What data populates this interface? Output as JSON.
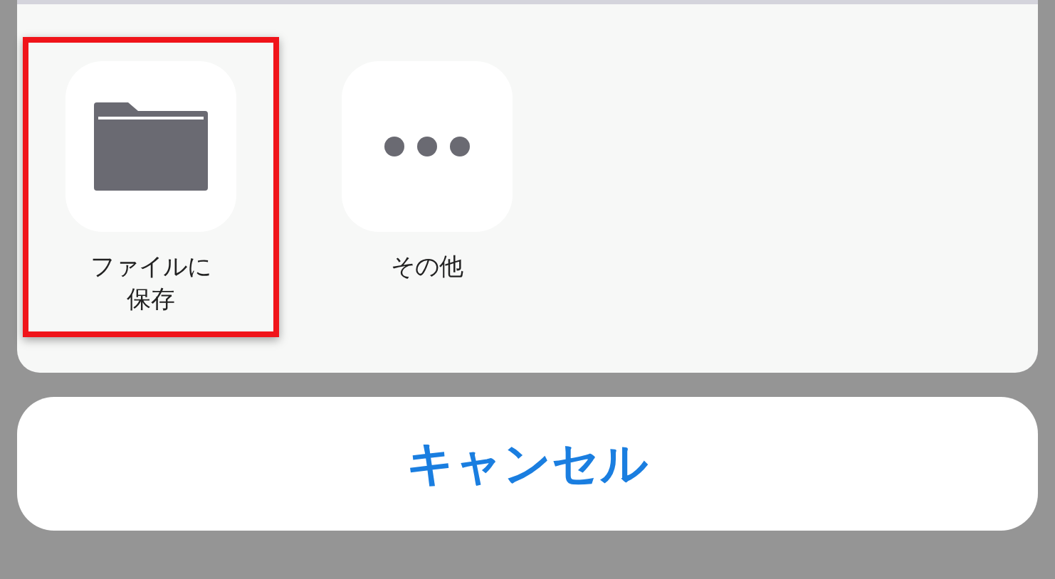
{
  "share_sheet": {
    "actions": [
      {
        "kind": "folder",
        "label": "ファイルに保存",
        "highlighted": true
      },
      {
        "kind": "more",
        "label": "その他",
        "highlighted": false
      }
    ]
  },
  "cancel_button": {
    "label": "キャンセル"
  }
}
